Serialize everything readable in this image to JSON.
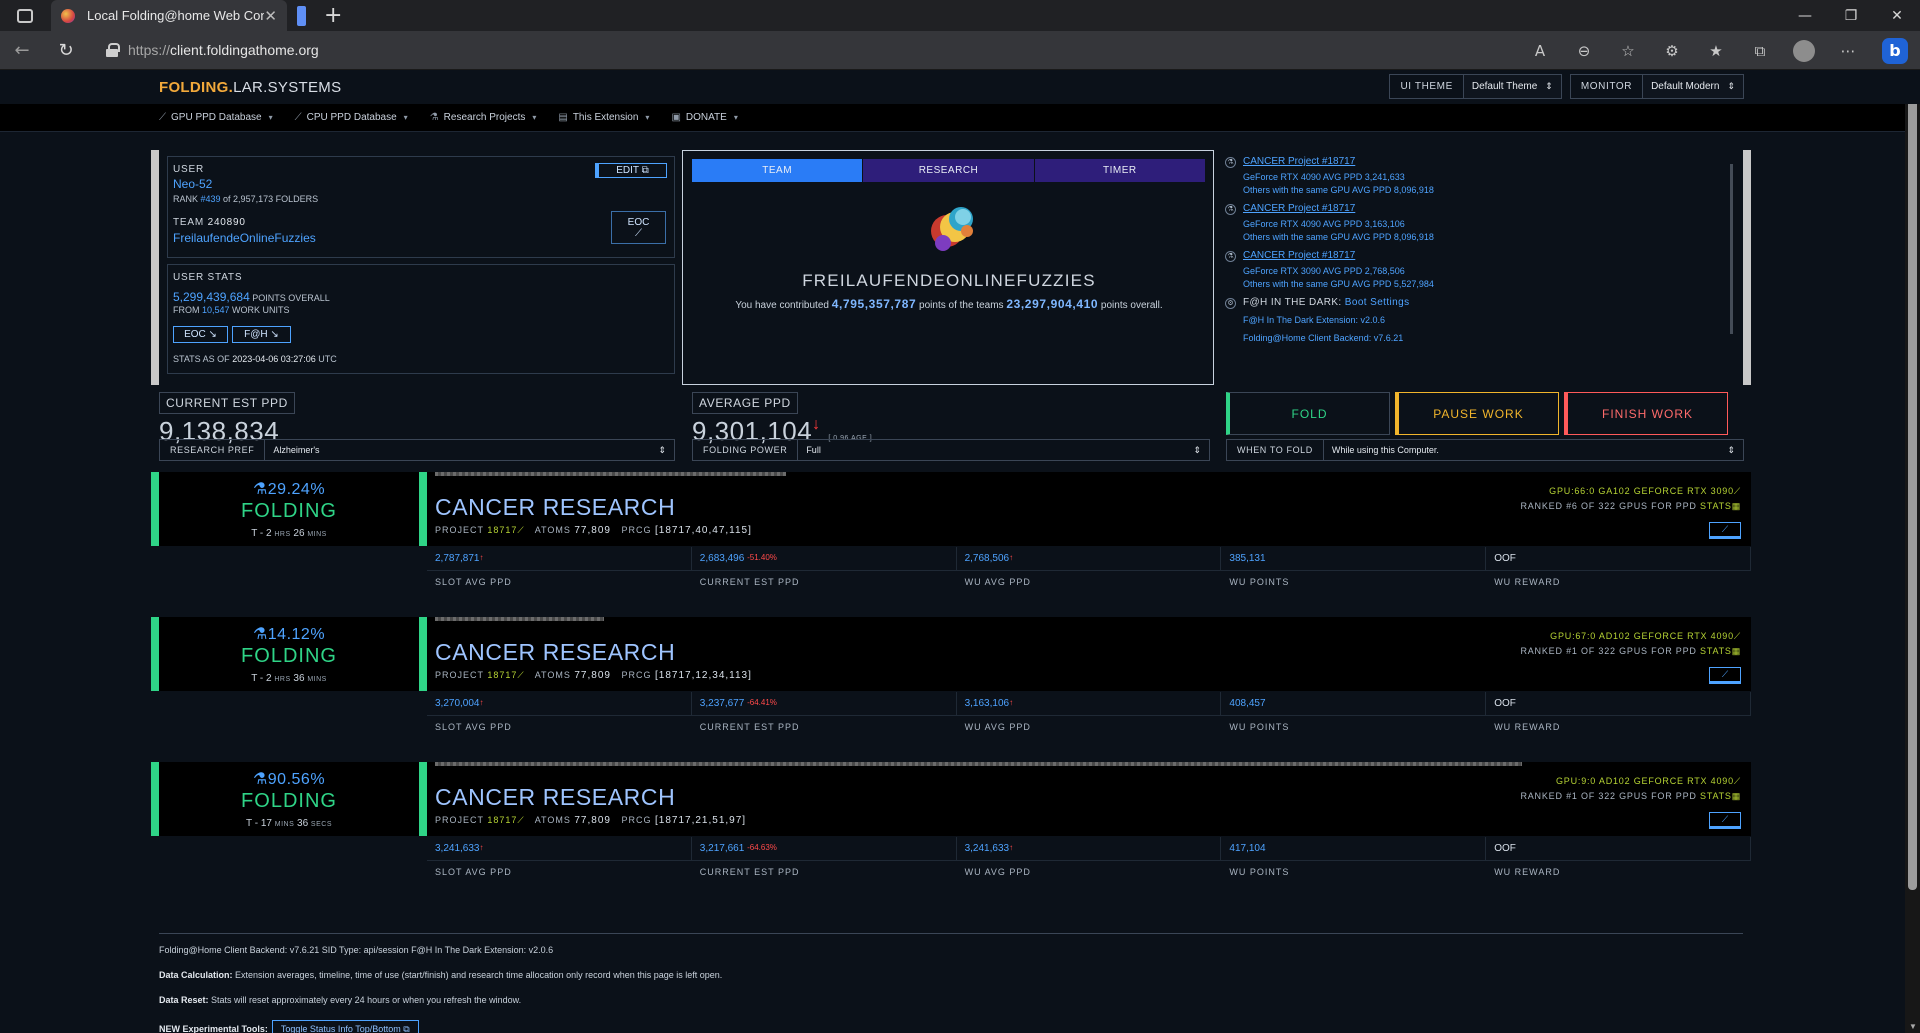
{
  "browser": {
    "tab_title": "Local Folding@home Web Contr",
    "url_prefix": "https://",
    "url_host": "client.foldingathome.org"
  },
  "header": {
    "brand_a": "FOLDING.",
    "brand_b": "LAR.SYSTEMS",
    "ui_theme_label": "UI THEME",
    "ui_theme_value": "Default Theme",
    "monitor_label": "MONITOR",
    "monitor_value": "Default Modern"
  },
  "menu": [
    {
      "label": "GPU PPD Database"
    },
    {
      "label": "CPU PPD Database"
    },
    {
      "label": "Research Projects"
    },
    {
      "label": "This Extension"
    },
    {
      "label": "DONATE"
    }
  ],
  "user": {
    "label": "USER",
    "name": "Neo-52",
    "rank_prefix": "RANK ",
    "rank": "#439",
    "rank_suffix": " of 2,957,173 FOLDERS",
    "edit_label": "EDIT ⧉",
    "team_label": "TEAM",
    "team_id": "240890",
    "team_name": "FreilaufendeOnlineFuzzies",
    "eoc_label": "EOC",
    "stats_label": "USER STATS",
    "points": "5,299,439,684",
    "points_suffix": " POINTS OVERALL",
    "from_prefix": "FROM ",
    "work_units": "10,547",
    "work_units_suffix": " WORK UNITS",
    "btn_eoc": "EOC ↘",
    "btn_fah": "F@H ↘",
    "stats_as_of_prefix": "STATS AS OF ",
    "stats_as_of": "2023-04-06 03:27:06",
    "stats_as_of_suffix": " UTC"
  },
  "team_panel": {
    "tabs": [
      "TEAM",
      "RESEARCH",
      "TIMER"
    ],
    "team_name": "FREILAUFENDEONLINEFUZZIES",
    "contrib_a": "You have contributed ",
    "contrib_points": "4,795,357,787",
    "contrib_b": " points of the teams ",
    "team_points": "23,297,904,410",
    "contrib_c": " points overall."
  },
  "activity": [
    {
      "title": "CANCER Project #18717",
      "gpu": "GeForce RTX 4090 AVG PPD ",
      "gpu_ppd": "3,241,633",
      "others": "Others with the same GPU AVG PPD ",
      "others_ppd": "8,096,918"
    },
    {
      "title": "CANCER Project #18717",
      "gpu": "GeForce RTX 4090 AVG PPD ",
      "gpu_ppd": "3,163,106",
      "others": "Others with the same GPU AVG PPD ",
      "others_ppd": "8,096,918"
    },
    {
      "title": "CANCER Project #18717",
      "gpu": "GeForce RTX 3090 AVG PPD ",
      "gpu_ppd": "2,768,506",
      "others": "Others with the same GPU AVG PPD ",
      "others_ppd": "5,527,984"
    }
  ],
  "in_the_dark": {
    "label": "F@H IN THE DARK: ",
    "boot_settings": "Boot Settings",
    "ext_label": "F@H In The Dark Extension: ",
    "ext_version": "v2.0.6",
    "backend_label": "Folding@Home Client Backend: ",
    "backend_version": "v7.6.21"
  },
  "ppd": {
    "current_label": "CURRENT EST PPD",
    "current_value": "9,138,834",
    "average_label": "AVERAGE PPD",
    "average_value": "9,301,104",
    "age": "[ 0.96 AGE ]"
  },
  "controls": {
    "fold": "FOLD",
    "pause": "PAUSE WORK",
    "finish": "FINISH WORK",
    "research_pref_label": "RESEARCH PREF",
    "research_pref_value": "Alzheimer's",
    "folding_power_label": "FOLDING POWER",
    "folding_power_value": "Full",
    "when_label": "WHEN TO FOLD",
    "when_value": "While using this Computer."
  },
  "slot_labels": [
    "SLOT AVG PPD",
    "CURRENT EST PPD",
    "WU AVG PPD",
    "WU POINTS",
    "WU REWARD"
  ],
  "slots": [
    {
      "pct": "29.24%",
      "progress": 0.2924,
      "status": "FOLDING",
      "eta_a": "T - 2 ",
      "eta_u1": "HRS",
      "eta_b": " 26 ",
      "eta_u2": "MINS",
      "cause": "CANCER RESEARCH",
      "project_label": "PROJECT ",
      "project": "18717",
      "atoms_label": "ATOMS ",
      "atoms": "77,809",
      "prcg_label": "PRCG ",
      "prcg": "[18717,40,47,115]",
      "gpu": "GPU:66:0 GA102 GEFORCE RTX 3090",
      "rank_a": "RANKED ",
      "rank": "#6",
      "rank_b": " OF 322 GPUS FOR PPD ",
      "stats": "STATS",
      "slot_avg": "2,787,871",
      "cur_est": "2,683,496",
      "cur_est_delta": "-51.40%",
      "wu_avg": "2,768,506",
      "wu_points": "385,131",
      "wu_reward": "OOF"
    },
    {
      "pct": "14.12%",
      "progress": 0.1412,
      "status": "FOLDING",
      "eta_a": "T - 2 ",
      "eta_u1": "HRS",
      "eta_b": " 36 ",
      "eta_u2": "MINS",
      "cause": "CANCER RESEARCH",
      "project_label": "PROJECT ",
      "project": "18717",
      "atoms_label": "ATOMS ",
      "atoms": "77,809",
      "prcg_label": "PRCG ",
      "prcg": "[18717,12,34,113]",
      "gpu": "GPU:67:0 AD102 GEFORCE RTX 4090",
      "rank_a": "RANKED ",
      "rank": "#1",
      "rank_b": " OF 322 GPUS FOR PPD ",
      "stats": "STATS",
      "slot_avg": "3,270,004",
      "cur_est": "3,237,677",
      "cur_est_delta": "-64.41%",
      "wu_avg": "3,163,106",
      "wu_points": "408,457",
      "wu_reward": "OOF"
    },
    {
      "pct": "90.56%",
      "progress": 0.9056,
      "status": "FOLDING",
      "eta_a": "T - 17 ",
      "eta_u1": "MINS",
      "eta_b": " 36 ",
      "eta_u2": "SECS",
      "cause": "CANCER RESEARCH",
      "project_label": "PROJECT ",
      "project": "18717",
      "atoms_label": "ATOMS ",
      "atoms": "77,809",
      "prcg_label": "PRCG ",
      "prcg": "[18717,21,51,97]",
      "gpu": "GPU:9:0 AD102 GEFORCE RTX 4090",
      "rank_a": "RANKED ",
      "rank": "#1",
      "rank_b": " OF 322 GPUS FOR PPD ",
      "stats": "STATS",
      "slot_avg": "3,241,633",
      "cur_est": "3,217,661",
      "cur_est_delta": "-64.63%",
      "wu_avg": "3,241,633",
      "wu_points": "417,104",
      "wu_reward": "OOF"
    }
  ],
  "footer": {
    "line1": "Folding@Home Client Backend: v7.6.21   SID Type: api/session   F@H In The Dark Extension: v2.0.6",
    "calc_label": "Data Calculation:",
    "calc_text": " Extension averages, timeline, time of use (start/finish) and research time allocation only record when this page is left open.",
    "reset_label": "Data Reset:",
    "reset_text": " Stats will reset approximately every 24 hours or when you refresh the window.",
    "tools_label": "NEW Experimental Tools:",
    "toggle_label": "Toggle Status Info Top/Bottom ⧉"
  },
  "colors": {
    "accent": "#4ea3ff",
    "green": "#2fd487",
    "yellow": "#f1b52c",
    "red": "#ff5a5a",
    "lime": "#b6d334"
  }
}
